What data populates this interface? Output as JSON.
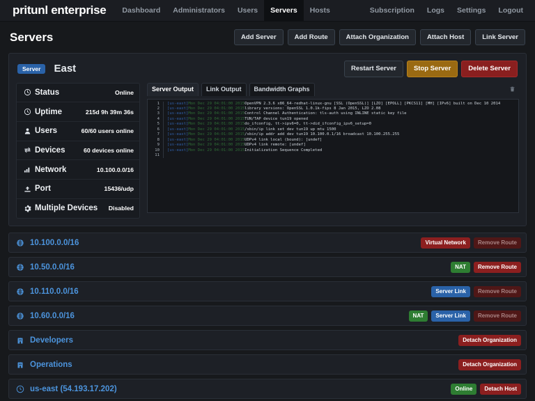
{
  "navbar": {
    "brand": "pritunl enterprise",
    "left_items": [
      {
        "label": "Dashboard",
        "active": false
      },
      {
        "label": "Administrators",
        "active": false
      },
      {
        "label": "Users",
        "active": false
      },
      {
        "label": "Servers",
        "active": true
      },
      {
        "label": "Hosts",
        "active": false
      }
    ],
    "right_items": [
      {
        "label": "Subscription"
      },
      {
        "label": "Logs"
      },
      {
        "label": "Settings"
      },
      {
        "label": "Logout"
      }
    ]
  },
  "page": {
    "title": "Servers",
    "actions": [
      {
        "label": "Add Server",
        "style": "default"
      },
      {
        "label": "Add Route",
        "style": "default"
      },
      {
        "label": "Attach Organization",
        "style": "default"
      },
      {
        "label": "Attach Host",
        "style": "default"
      },
      {
        "label": "Link Server",
        "style": "default"
      }
    ]
  },
  "server": {
    "badge": "Server",
    "name": "East",
    "actions": [
      {
        "label": "Restart Server",
        "style": "default"
      },
      {
        "label": "Stop Server",
        "style": "warn"
      },
      {
        "label": "Delete Server",
        "style": "danger"
      }
    ],
    "info": [
      {
        "icon": "power-icon",
        "label": "Status",
        "value": "Online"
      },
      {
        "icon": "clock-icon",
        "label": "Uptime",
        "value": "215d 9h 39m 36s"
      },
      {
        "icon": "user-icon",
        "label": "Users",
        "value": "60/60 users online"
      },
      {
        "icon": "exchange-icon",
        "label": "Devices",
        "value": "60 devices online"
      },
      {
        "icon": "signal-icon",
        "label": "Network",
        "value": "10.100.0.0/16"
      },
      {
        "icon": "upload-icon",
        "label": "Port",
        "value": "15436/udp"
      },
      {
        "icon": "gear-icon",
        "label": "Multiple Devices",
        "value": "Disabled"
      }
    ]
  },
  "output": {
    "tabs": [
      {
        "label": "Server Output",
        "active": true
      },
      {
        "label": "Link Output",
        "active": false
      },
      {
        "label": "Bandwidth Graphs",
        "active": false
      }
    ],
    "clear_icon": "trash-icon",
    "lines": [
      {
        "n": "1",
        "host": "[us-east]",
        "date": "Mon Dec 29 04:01:00 2015",
        "msg": "OpenVPN 2.3.6 x86_64-redhat-linux-gnu [SSL (OpenSSL)] [LZO] [EPOLL] [PKCS11] [MH] [IPv6] built on Dec 10 2014"
      },
      {
        "n": "2",
        "host": "[us-east]",
        "date": "Mon Dec 29 04:01:00 2015",
        "msg": "library versions: OpenSSL 1.0.1k-fips 8 Jan 2015, LZO 2.08"
      },
      {
        "n": "3",
        "host": "[us-east]",
        "date": "Mon Dec 29 04:01:00 2015",
        "msg": "Control Channel Authentication: tls-auth using INLINE static key file"
      },
      {
        "n": "4",
        "host": "[us-east]",
        "date": "Mon Dec 29 04:01:00 2015",
        "msg": "TUN/TAP device tun19 opened"
      },
      {
        "n": "5",
        "host": "[us-east]",
        "date": "Mon Dec 29 04:01:00 2015",
        "msg": "do_ifconfig, tt->ipv6=0, tt->did_ifconfig_ipv6_setup=0"
      },
      {
        "n": "6",
        "host": "[us-east]",
        "date": "Mon Dec 29 04:01:00 2015",
        "msg": "/sbin/ip link set dev tun19 up mtu 1500"
      },
      {
        "n": "7",
        "host": "[us-east]",
        "date": "Mon Dec 29 04:01:00 2015",
        "msg": "/sbin/ip addr add dev tun19 10.100.0.1/16 broadcast 10.100.255.255"
      },
      {
        "n": "8",
        "host": "[us-east]",
        "date": "Mon Dec 29 04:01:00 2015",
        "msg": "UDPv4 link local (bound): [undef]"
      },
      {
        "n": "9",
        "host": "[us-east]",
        "date": "Mon Dec 29 04:01:00 2015",
        "msg": "UDPv4 link remote: [undef]"
      },
      {
        "n": "10",
        "host": "[us-east]",
        "date": "Mon Dec 29 04:01:00 2015",
        "msg": "Initialization Sequence Completed"
      },
      {
        "n": "11",
        "host": "",
        "date": "",
        "msg": ""
      }
    ]
  },
  "rows": [
    {
      "icon": "globe-icon",
      "label": "10.100.0.0/16",
      "tags": [
        {
          "label": "Virtual Network",
          "style": "vnet"
        },
        {
          "label": "Remove Route",
          "style": "remove-dim"
        }
      ]
    },
    {
      "icon": "globe-icon",
      "label": "10.50.0.0/16",
      "tags": [
        {
          "label": "NAT",
          "style": "nat"
        },
        {
          "label": "Remove Route",
          "style": "remove"
        }
      ]
    },
    {
      "icon": "globe-icon",
      "label": "10.110.0.0/16",
      "tags": [
        {
          "label": "Server Link",
          "style": "slink"
        },
        {
          "label": "Remove Route",
          "style": "remove-dim"
        }
      ]
    },
    {
      "icon": "globe-icon",
      "label": "10.60.0.0/16",
      "tags": [
        {
          "label": "NAT",
          "style": "nat"
        },
        {
          "label": "Server Link",
          "style": "slink"
        },
        {
          "label": "Remove Route",
          "style": "remove-dim"
        }
      ]
    },
    {
      "icon": "building-icon",
      "label": "Developers",
      "tags": [
        {
          "label": "Detach Organization",
          "style": "remove"
        }
      ]
    },
    {
      "icon": "building-icon",
      "label": "Operations",
      "tags": [
        {
          "label": "Detach Organization",
          "style": "remove"
        }
      ]
    },
    {
      "icon": "host-icon",
      "label": "us-east (54.193.17.202)",
      "tags": [
        {
          "label": "Online",
          "style": "online"
        },
        {
          "label": "Detach Host",
          "style": "remove"
        }
      ]
    }
  ]
}
